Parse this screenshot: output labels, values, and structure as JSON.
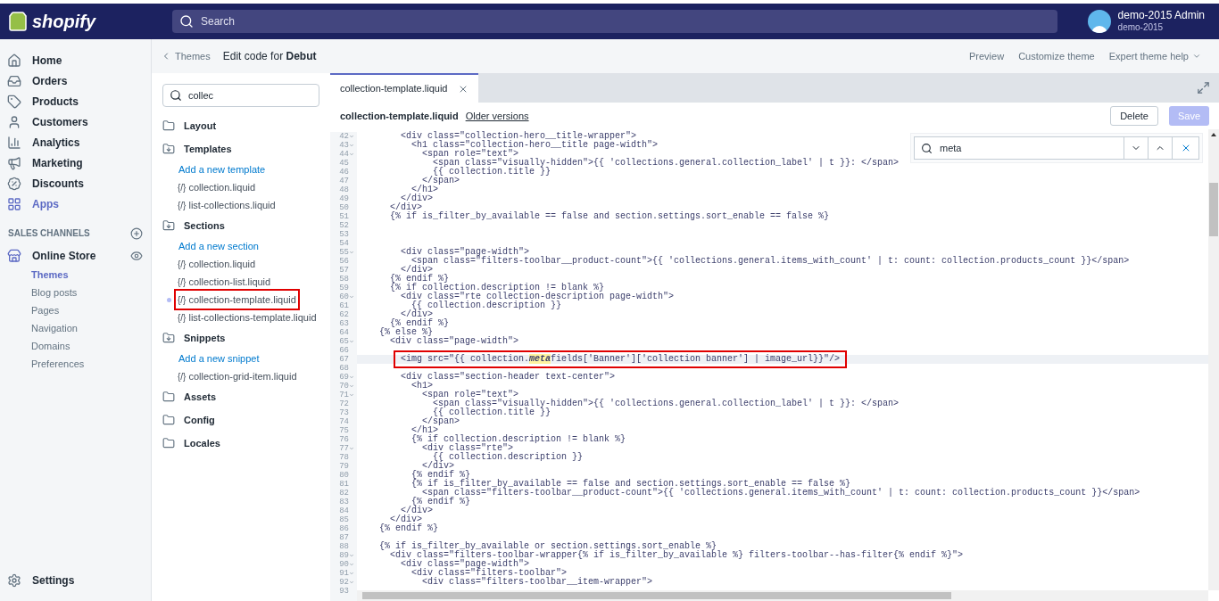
{
  "topbar": {
    "logo": "shopify",
    "search": {
      "placeholder": "Search"
    },
    "account": {
      "name": "demo-2015 Admin",
      "store": "demo-2015"
    }
  },
  "nav": {
    "items": [
      {
        "label": "Home",
        "selected": false
      },
      {
        "label": "Orders",
        "selected": false
      },
      {
        "label": "Products",
        "selected": false
      },
      {
        "label": "Customers",
        "selected": false
      },
      {
        "label": "Analytics",
        "selected": false
      },
      {
        "label": "Marketing",
        "selected": false
      },
      {
        "label": "Discounts",
        "selected": false
      },
      {
        "label": "Apps",
        "selected": true
      }
    ],
    "channels_heading": "SALES CHANNELS",
    "channel": {
      "label": "Online Store",
      "subitems": [
        {
          "label": "Themes",
          "selected": true
        },
        {
          "label": "Blog posts",
          "selected": false
        },
        {
          "label": "Pages",
          "selected": false
        },
        {
          "label": "Navigation",
          "selected": false
        },
        {
          "label": "Domains",
          "selected": false
        },
        {
          "label": "Preferences",
          "selected": false
        }
      ]
    },
    "settings": "Settings"
  },
  "header": {
    "back": "Themes",
    "title": "Edit code for **Debut**",
    "actions": [
      {
        "label": "Preview",
        "caret": false
      },
      {
        "label": "Customize theme",
        "caret": false
      },
      {
        "label": "Expert theme help",
        "caret": true
      }
    ]
  },
  "files": {
    "search": {
      "value": "collec"
    },
    "folders": [
      {
        "name": "Layout",
        "expanded": false
      },
      {
        "name": "Templates",
        "expanded": true,
        "children": [
          {
            "kind": "add",
            "label": "Add a new template"
          },
          {
            "kind": "file",
            "glyph": "{/}",
            "label": "collection.liquid",
            "selected": false,
            "annotated": false
          },
          {
            "kind": "file",
            "glyph": "{/}",
            "label": "list-collections.liquid",
            "selected": false,
            "annotated": false
          }
        ]
      },
      {
        "name": "Sections",
        "expanded": true,
        "children": [
          {
            "kind": "add",
            "label": "Add a new section"
          },
          {
            "kind": "file",
            "glyph": "{/}",
            "label": "collection.liquid",
            "selected": false,
            "annotated": false
          },
          {
            "kind": "file",
            "glyph": "{/}",
            "label": "collection-list.liquid",
            "selected": false,
            "annotated": false
          },
          {
            "kind": "file",
            "glyph": "{/}",
            "label": "collection-template.liquid",
            "selected": true,
            "annotated": true
          },
          {
            "kind": "file",
            "glyph": "{/}",
            "label": "list-collections-template.liquid",
            "selected": false,
            "annotated": false
          }
        ]
      },
      {
        "name": "Snippets",
        "expanded": true,
        "children": [
          {
            "kind": "add",
            "label": "Add a new snippet"
          },
          {
            "kind": "file",
            "glyph": "{/}",
            "label": "collection-grid-item.liquid",
            "selected": false,
            "annotated": false
          }
        ]
      },
      {
        "name": "Assets",
        "expanded": false
      },
      {
        "name": "Config",
        "expanded": false
      },
      {
        "name": "Locales",
        "expanded": false
      }
    ]
  },
  "editor": {
    "tabs": [
      {
        "label": "collection-template.liquid",
        "selected": true
      }
    ],
    "file_name": "collection-template.liquid",
    "older_versions": "Older versions",
    "buttons": [
      {
        "label": "Delete",
        "disabled": false
      },
      {
        "label": "Save",
        "disabled": true
      }
    ],
    "find": {
      "value": "meta"
    },
    "lines": [
      {
        "n": "42",
        "fold": true,
        "text": "        <div class=\"collection-hero__title-wrapper\">"
      },
      {
        "n": "43",
        "fold": true,
        "text": "          <h1 class=\"collection-hero__title page-width\">"
      },
      {
        "n": "44",
        "fold": true,
        "text": "            <span role=\"text\">"
      },
      {
        "n": "45",
        "fold": false,
        "text": "              <span class=\"visually-hidden\">{{ 'collections.general.collection_label' | t }}: </span>"
      },
      {
        "n": "46",
        "fold": false,
        "text": "              {{ collection.title }}"
      },
      {
        "n": "47",
        "fold": false,
        "text": "            </span>"
      },
      {
        "n": "48",
        "fold": false,
        "text": "          </h1>"
      },
      {
        "n": "49",
        "fold": false,
        "text": "        </div>"
      },
      {
        "n": "50",
        "fold": false,
        "text": "      </div>"
      },
      {
        "n": "51",
        "fold": false,
        "text": "      {% if is_filter_by_available == false and section.settings.sort_enable == false %}"
      },
      {
        "n": "52",
        "fold": false
      },
      {
        "n": "53",
        "fold": false
      },
      {
        "n": "54",
        "fold": false
      },
      {
        "n": "55",
        "fold": true,
        "text": "        <div class=\"page-width\">"
      },
      {
        "n": "56",
        "fold": false,
        "text": "          <span class=\"filters-toolbar__product-count\">{{ 'collections.general.items_with_count' | t: count: collection.products_count }}</span>"
      },
      {
        "n": "57",
        "fold": false,
        "text": "        </div>"
      },
      {
        "n": "58",
        "fold": false,
        "text": "      {% endif %}"
      },
      {
        "n": "59",
        "fold": false,
        "text": "      {% if collection.description != blank %}"
      },
      {
        "n": "60",
        "fold": true,
        "text": "        <div class=\"rte collection-description page-width\">"
      },
      {
        "n": "61",
        "fold": false,
        "text": "          {{ collection.description }}"
      },
      {
        "n": "62",
        "fold": false,
        "text": "        </div>"
      },
      {
        "n": "63",
        "fold": false,
        "text": "      {% endif %}"
      },
      {
        "n": "64",
        "fold": false,
        "text": "    {% else %}"
      },
      {
        "n": "65",
        "fold": true,
        "text": "      <div class=\"page-width\">"
      },
      {
        "n": "66",
        "fold": false
      },
      {
        "n": "67",
        "fold": false,
        "active": true,
        "annotated": true,
        "parts": [
          {
            "text": "<img src=\"{{ collection.",
            "match": false
          },
          {
            "text": "meta",
            "match": true
          },
          {
            "text": "fields['Banner']['collection banner'] | image_url}}\"/>",
            "match": false
          }
        ]
      },
      {
        "n": "68",
        "fold": false
      },
      {
        "n": "69",
        "fold": true,
        "text": "        <div class=\"section-header text-center\">"
      },
      {
        "n": "70",
        "fold": true,
        "text": "          <h1>"
      },
      {
        "n": "71",
        "fold": true,
        "text": "            <span role=\"text\">"
      },
      {
        "n": "72",
        "fold": false,
        "text": "              <span class=\"visually-hidden\">{{ 'collections.general.collection_label' | t }}: </span>"
      },
      {
        "n": "73",
        "fold": false,
        "text": "              {{ collection.title }}"
      },
      {
        "n": "74",
        "fold": false,
        "text": "            </span>"
      },
      {
        "n": "75",
        "fold": false,
        "text": "          </h1>"
      },
      {
        "n": "76",
        "fold": false,
        "text": "          {% if collection.description != blank %}"
      },
      {
        "n": "77",
        "fold": true,
        "text": "            <div class=\"rte\">"
      },
      {
        "n": "78",
        "fold": false,
        "text": "              {{ collection.description }}"
      },
      {
        "n": "79",
        "fold": false,
        "text": "            </div>"
      },
      {
        "n": "80",
        "fold": false,
        "text": "          {% endif %}"
      },
      {
        "n": "81",
        "fold": false,
        "text": "          {% if is_filter_by_available == false and section.settings.sort_enable == false %}"
      },
      {
        "n": "82",
        "fold": false,
        "text": "            <span class=\"filters-toolbar__product-count\">{{ 'collections.general.items_with_count' | t: count: collection.products_count }}</span>"
      },
      {
        "n": "83",
        "fold": false,
        "text": "          {% endif %}"
      },
      {
        "n": "84",
        "fold": false,
        "text": "        </div>"
      },
      {
        "n": "85",
        "fold": false,
        "text": "      </div>"
      },
      {
        "n": "86",
        "fold": false,
        "text": "    {% endif %}"
      },
      {
        "n": "87",
        "fold": false
      },
      {
        "n": "88",
        "fold": false,
        "text": "    {% if is_filter_by_available or section.settings.sort_enable %}"
      },
      {
        "n": "89",
        "fold": true,
        "text": "      <div class=\"filters-toolbar-wrapper{% if is_filter_by_available %} filters-toolbar--has-filter{% endif %}\">"
      },
      {
        "n": "90",
        "fold": true,
        "text": "        <div class=\"page-width\">"
      },
      {
        "n": "91",
        "fold": true,
        "text": "          <div class=\"filters-toolbar\">"
      },
      {
        "n": "92",
        "fold": true,
        "text": "            <div class=\"filters-toolbar__item-wrapper\">"
      },
      {
        "n": "93",
        "fold": false
      }
    ]
  }
}
